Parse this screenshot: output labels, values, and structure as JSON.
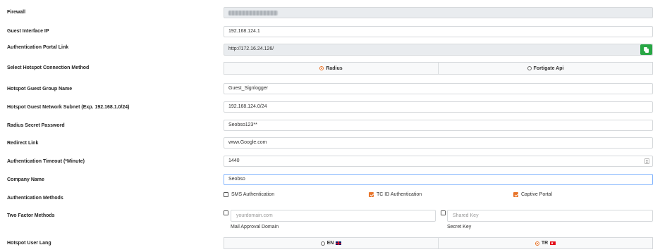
{
  "firewall": {
    "label": "Firewall",
    "value_masked": true
  },
  "guest_interface_ip": {
    "label": "Guest Interface IP",
    "value": "192.168.124.1"
  },
  "auth_portal_link": {
    "label": "Authentication Portal Link",
    "value": "http://172.16.24.126/",
    "copy_icon": "copy-icon"
  },
  "connection_method": {
    "label": "Select Hotspot Connection Method",
    "options": [
      {
        "label": "Radius",
        "selected": true
      },
      {
        "label": "Fortigate Api",
        "selected": false
      }
    ]
  },
  "guest_group_name": {
    "label": "Hotspot Guest Group Name",
    "value": "Guest_Signlogger"
  },
  "guest_network_subnet": {
    "label": "Hotspot Guest Network Subnet (Exp. 192.168.1.0/24)",
    "value": "192.168.124.0/24"
  },
  "radius_secret": {
    "label": "Radius Secret Password",
    "value": "Seobso123**"
  },
  "redirect_link": {
    "label": "Redirect Link",
    "value": "www.Google.com"
  },
  "auth_timeout": {
    "label": "Authentication Timeout (*Minute)",
    "value": "1440"
  },
  "company_name": {
    "label": "Company Name",
    "value": "Seobso"
  },
  "auth_methods": {
    "label": "Authentication Methods",
    "options": [
      {
        "label": "SMS Authentication",
        "checked": false
      },
      {
        "label": "TC ID Authentication",
        "checked": true
      },
      {
        "label": "Captive Portal",
        "checked": true
      }
    ]
  },
  "two_factor": {
    "label": "Two Factor Methods",
    "mail": {
      "placeholder": "yourdomain.com",
      "caption": "Mail Approval Domain",
      "checked": false
    },
    "secret": {
      "placeholder": "Shared Key",
      "caption": "Secret Key",
      "checked": false
    }
  },
  "user_lang": {
    "label": "Hotspot User Lang",
    "options": [
      {
        "label": "EN",
        "selected": false,
        "flag": "uk-flag-icon"
      },
      {
        "label": "TR",
        "selected": true,
        "flag": "tr-flag-icon"
      }
    ]
  },
  "colors": {
    "accent": "#e8742a",
    "copy_button": "#28a745",
    "readonly_bg": "#e9ecef",
    "border": "#d6d9dc"
  }
}
